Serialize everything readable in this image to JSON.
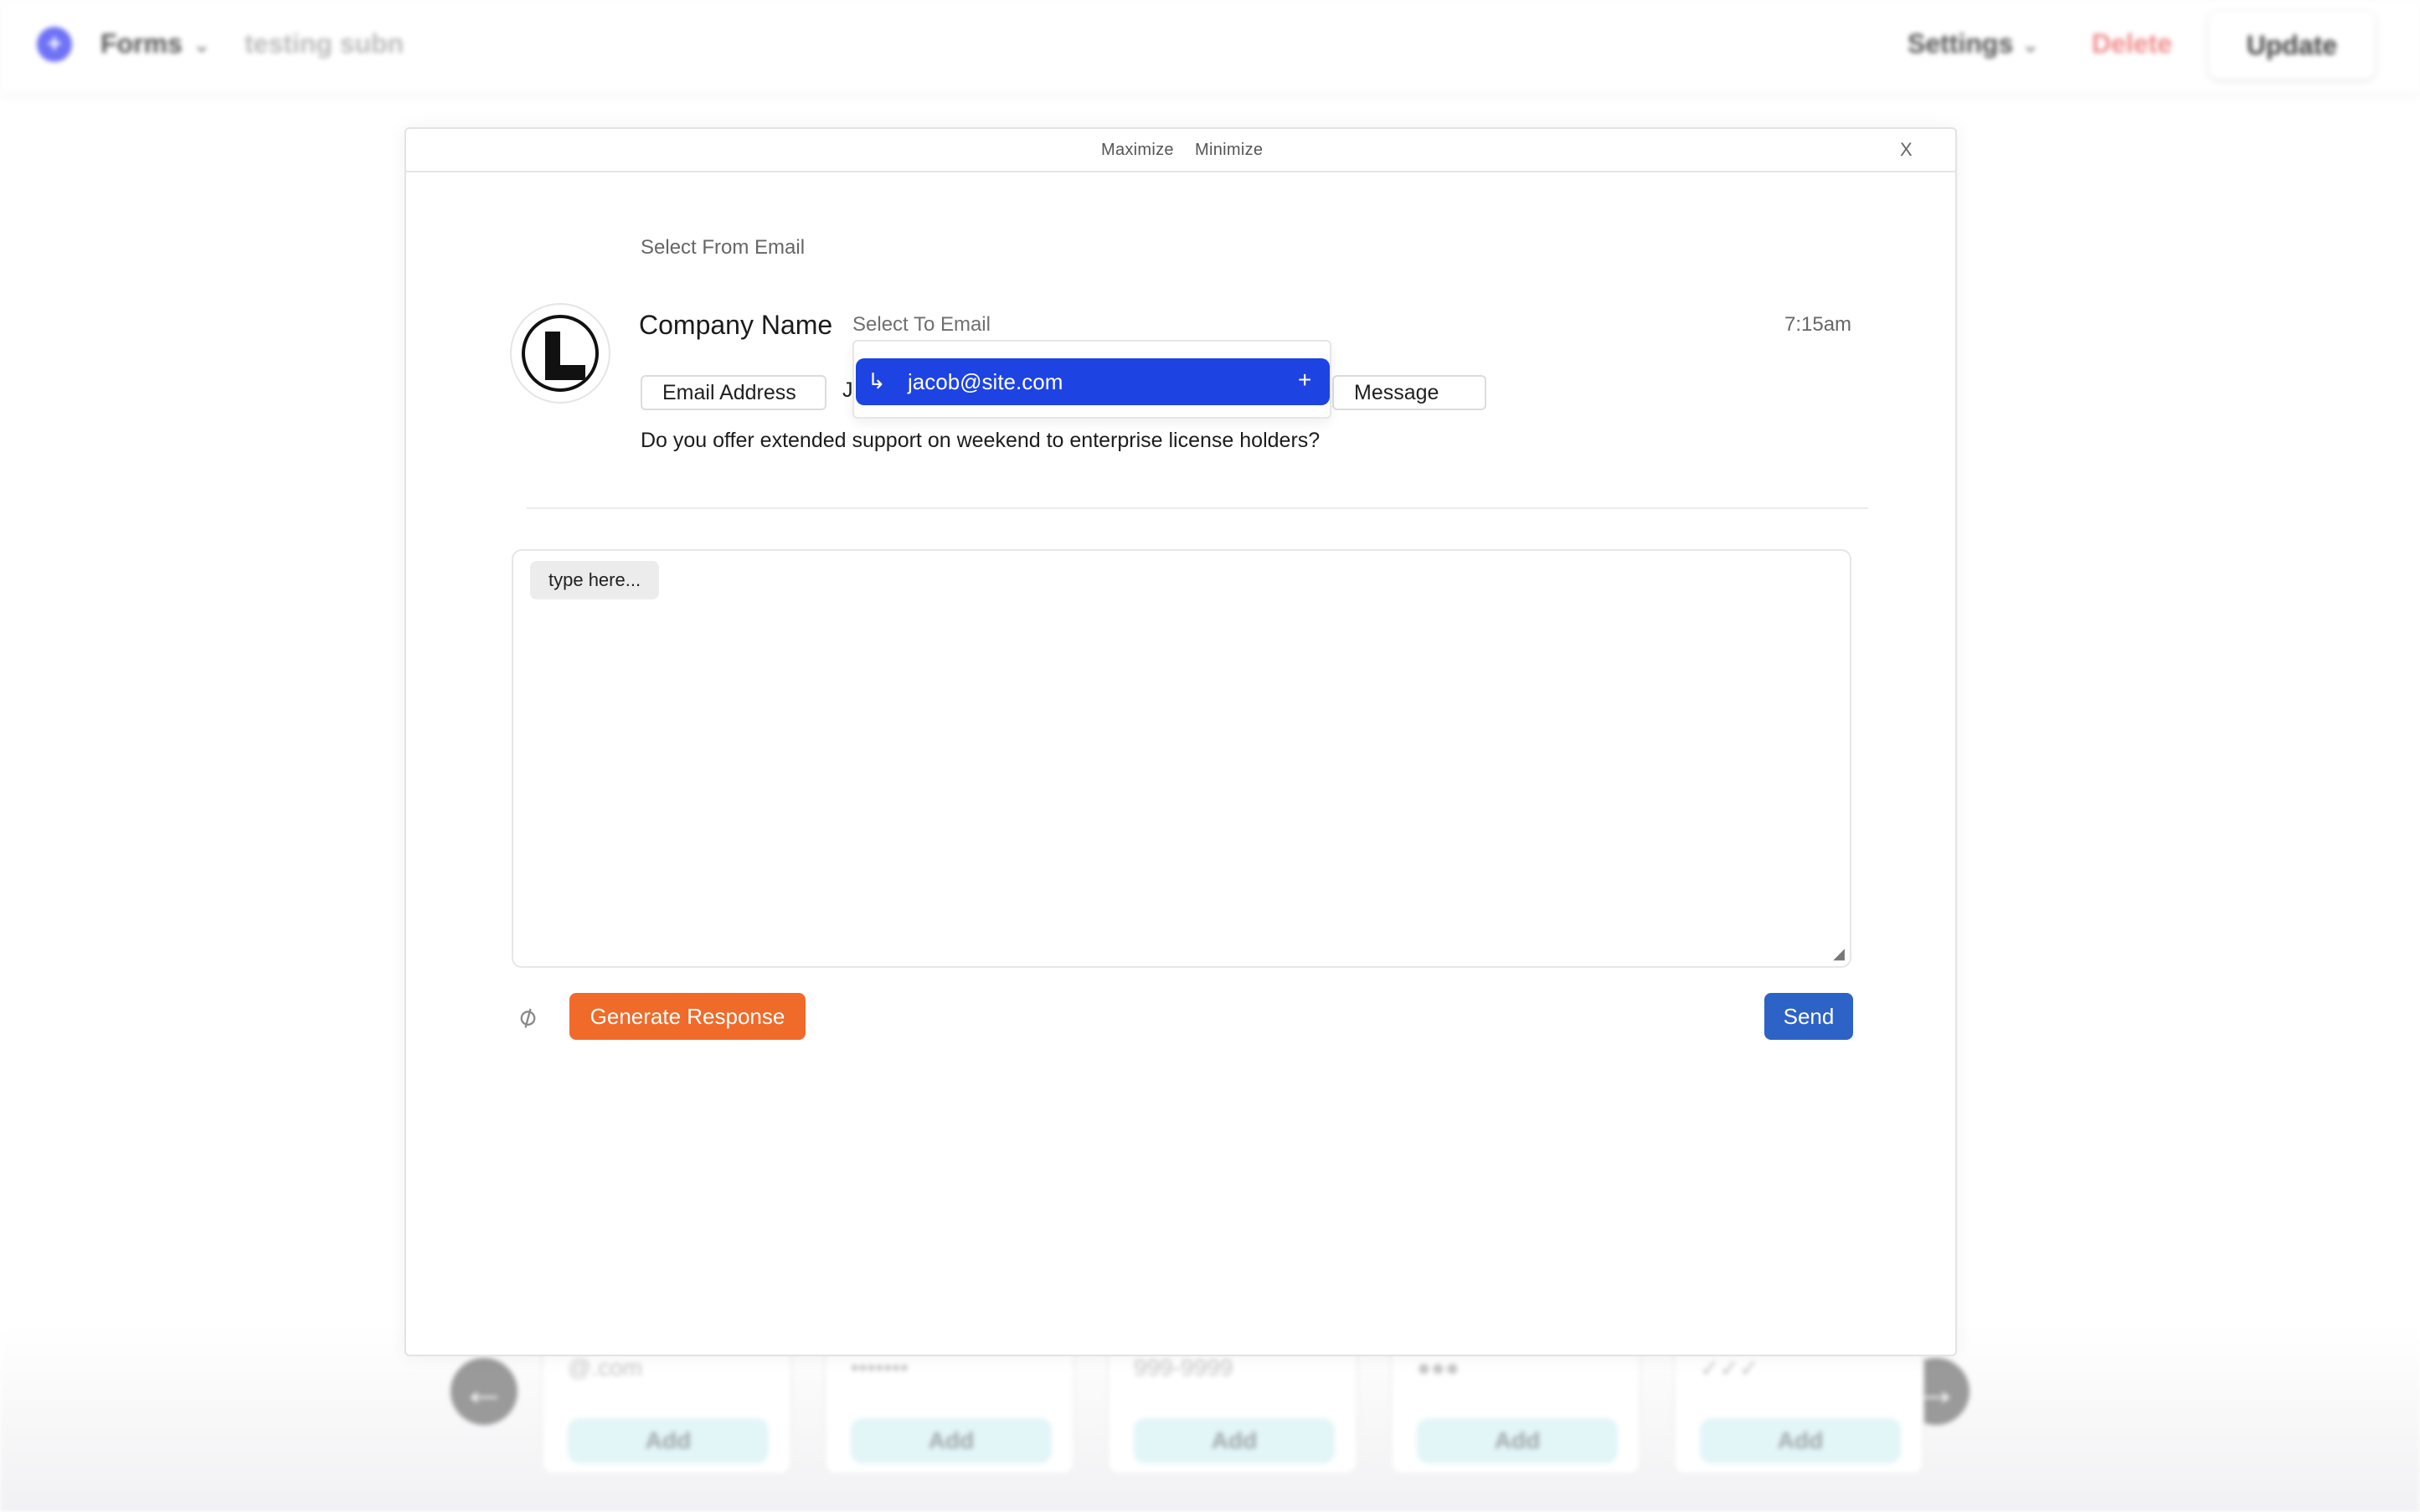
{
  "background": {
    "topbar": {
      "forms_label": "Forms",
      "submission_label": "testing subn",
      "settings_label": "Settings",
      "delete_label": "Delete",
      "update_label": "Update"
    },
    "cards": [
      {
        "text": "@.com",
        "add_label": "Add"
      },
      {
        "text": "•••••••",
        "add_label": "Add"
      },
      {
        "text": "999-9999",
        "add_label": "Add"
      },
      {
        "text": "●●●",
        "add_label": "Add"
      },
      {
        "text": "✓✓✓",
        "add_label": "Add"
      }
    ]
  },
  "modal": {
    "header": {
      "maximize_label": "Maximize",
      "minimize_label": "Minimize",
      "close_label": "X"
    },
    "select_from_email": "Select From Email",
    "company_name": "Company Name",
    "select_to_email": "Select To Email",
    "time": "7:15am",
    "tags": {
      "email_address": "Email Address",
      "partial": "J",
      "message": "Message"
    },
    "question": "Do you offer extended support on weekend to enterprise license holders?",
    "dropdown": {
      "option": "jacob@site.com"
    },
    "editor": {
      "placeholder": "type here..."
    },
    "footer": {
      "generate_label": "Generate Response",
      "send_label": "Send"
    }
  },
  "colors": {
    "generate_button": "#f06a2a",
    "send_button": "#2d62c7",
    "dropdown_selected": "#1d43e3",
    "delete_text": "#f08a8a"
  }
}
